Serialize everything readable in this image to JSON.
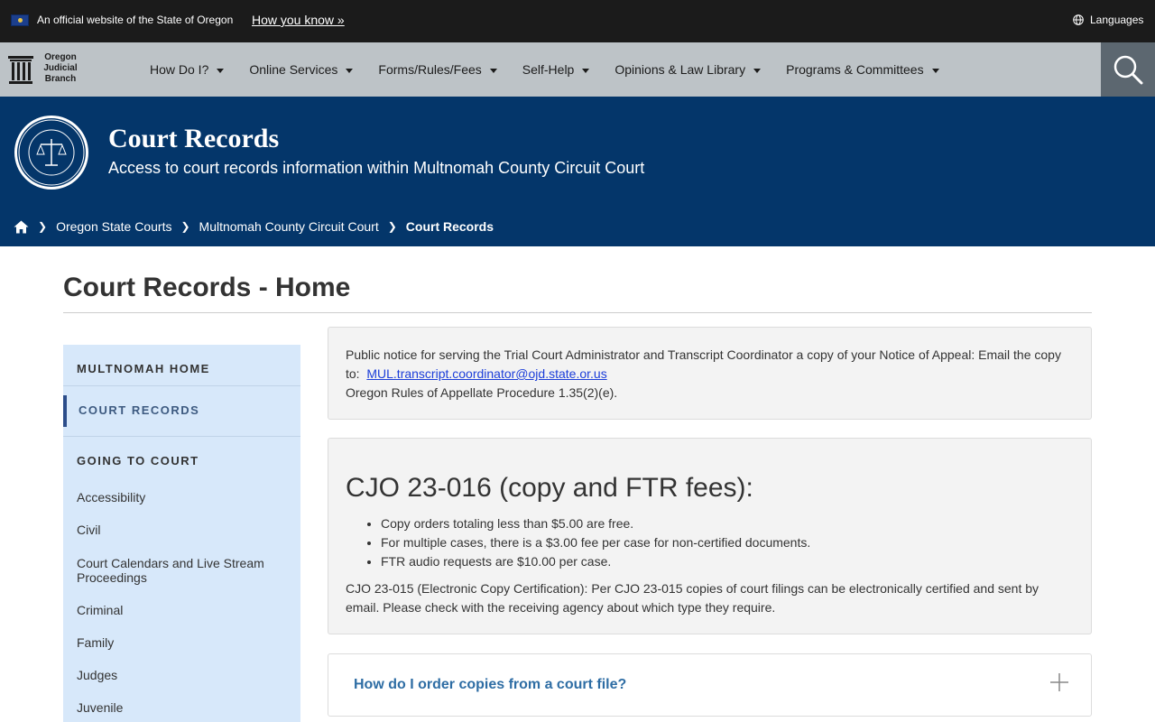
{
  "gov_bar": {
    "official_text": "An official website of the State of Oregon",
    "how_you_know": "How you know »",
    "languages": "Languages"
  },
  "header": {
    "logo_lines": [
      "Oregon",
      "Judicial",
      "Branch"
    ],
    "nav": [
      {
        "label": "How Do I?"
      },
      {
        "label": "Online Services"
      },
      {
        "label": "Forms/Rules/Fees"
      },
      {
        "label": "Self-Help"
      },
      {
        "label": "Opinions & Law Library"
      },
      {
        "label": "Programs & Committees"
      }
    ],
    "search_icon": "search-icon"
  },
  "hero": {
    "title": "Court Records",
    "subtitle": "Access to court records information within Multnomah County Circuit Court",
    "seal_icon": "judicial-department-seal"
  },
  "breadcrumb": {
    "home_icon": "home-icon",
    "items": [
      "Oregon State Courts",
      "Multnomah County Circuit Court"
    ],
    "current": "Court Records"
  },
  "page": {
    "title": "Court Records - Home"
  },
  "sidebar": {
    "home": "MULTNOMAH HOME",
    "active": "COURT RECORDS",
    "section_head": "GOING TO COURT",
    "links": [
      "Accessibility",
      "Civil",
      "Court Calendars and Live Stream Proceedings",
      "Criminal",
      "Family",
      "Judges",
      "Juvenile"
    ]
  },
  "notice": {
    "line1": "Public notice for serving the Trial Court Administrator and Transcript Coordinator a copy of your Notice of Appeal:  Email the copy to:",
    "email": "MUL.transcript.coordinator@ojd.state.or.us",
    "line2": "Oregon Rules of Appellate Procedure 1.35(2)(e)."
  },
  "cjo": {
    "heading": "CJO 23-016 (copy and FTR fees):",
    "bullets": [
      "Copy orders totaling less than $5.00 are free.",
      "For multiple cases, there is a $3.00 fee per case for non-certified documents.",
      "FTR audio requests are $10.00 per case."
    ],
    "note": "CJO 23-015 (Electronic Copy Certification): Per CJO 23-015 copies of court filings can be electronically certified and sent by email. Please check with the receiving agency about which type they require."
  },
  "accordion": {
    "label": "How do I order copies from a court file?",
    "expand_icon": "plus-icon"
  },
  "colors": {
    "gov_bar": "#1b1b1b",
    "nav_bar": "#bdc3c7",
    "hero": "#04366a",
    "sidebar": "#d7e8fa",
    "accent_link": "#2e6da4"
  }
}
